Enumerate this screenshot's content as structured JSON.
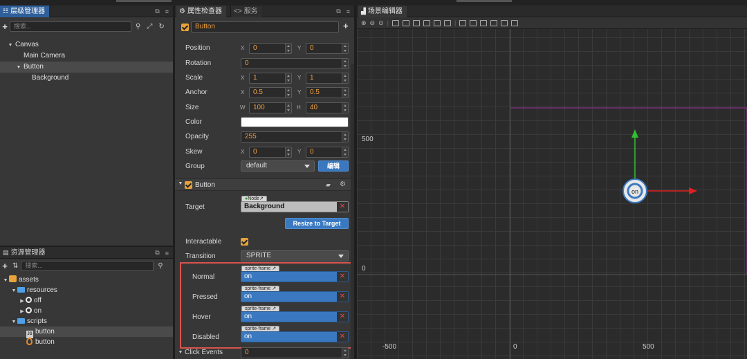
{
  "hierarchy": {
    "tab_label": "层级管理器",
    "search_placeholder": "搜索...",
    "nodes": [
      {
        "label": "Canvas",
        "expanded": true
      },
      {
        "label": "Main Camera"
      },
      {
        "label": "Button",
        "expanded": true,
        "selected": true
      },
      {
        "label": "Background"
      }
    ]
  },
  "assets": {
    "tab_label": "资源管理器",
    "search_placeholder": "搜索...",
    "items": [
      {
        "label": "assets",
        "type": "root"
      },
      {
        "label": "resources",
        "type": "folder"
      },
      {
        "label": "off",
        "type": "image"
      },
      {
        "label": "on",
        "type": "image"
      },
      {
        "label": "scripts",
        "type": "folder"
      },
      {
        "label": "button",
        "type": "script",
        "selected": true
      },
      {
        "label": "button",
        "type": "prefab"
      }
    ]
  },
  "inspector": {
    "tab_label": "属性检查器",
    "tab2_label": "服务",
    "node_name": "Button",
    "properties": {
      "position": {
        "label": "Position",
        "x_axis": "X",
        "y_axis": "Y",
        "x": "0",
        "y": "0"
      },
      "rotation": {
        "label": "Rotation",
        "value": "0"
      },
      "scale": {
        "label": "Scale",
        "x_axis": "X",
        "y_axis": "Y",
        "x": "1",
        "y": "1"
      },
      "anchor": {
        "label": "Anchor",
        "x_axis": "X",
        "y_axis": "Y",
        "x": "0.5",
        "y": "0.5"
      },
      "size": {
        "label": "Size",
        "w_axis": "W",
        "h_axis": "H",
        "w": "100",
        "h": "40"
      },
      "color": {
        "label": "Color",
        "value": "#ffffff"
      },
      "opacity": {
        "label": "Opacity",
        "value": "255"
      },
      "skew": {
        "label": "Skew",
        "x_axis": "X",
        "y_axis": "Y",
        "x": "0",
        "y": "0"
      },
      "group": {
        "label": "Group",
        "value": "default",
        "edit_label": "编辑"
      }
    },
    "button_component": {
      "title": "Button",
      "target": {
        "label": "Target",
        "tag": "Node",
        "value": "Background"
      },
      "resize_label": "Resize to Target",
      "interactable": {
        "label": "Interactable"
      },
      "transition": {
        "label": "Transition",
        "value": "SPRITE"
      },
      "sprite_tag": "sprite-frame",
      "states": [
        {
          "label": "Normal",
          "value": "on"
        },
        {
          "label": "Pressed",
          "value": "on"
        },
        {
          "label": "Hover",
          "value": "on"
        },
        {
          "label": "Disabled",
          "value": "on"
        }
      ],
      "click_events": {
        "label": "Click Events",
        "value": "0"
      }
    }
  },
  "scene": {
    "tab_label": "场景编辑器",
    "labels": {
      "y500": "500",
      "y0": "0",
      "xm500": "-500",
      "x0": "0",
      "x500": "500"
    }
  }
}
